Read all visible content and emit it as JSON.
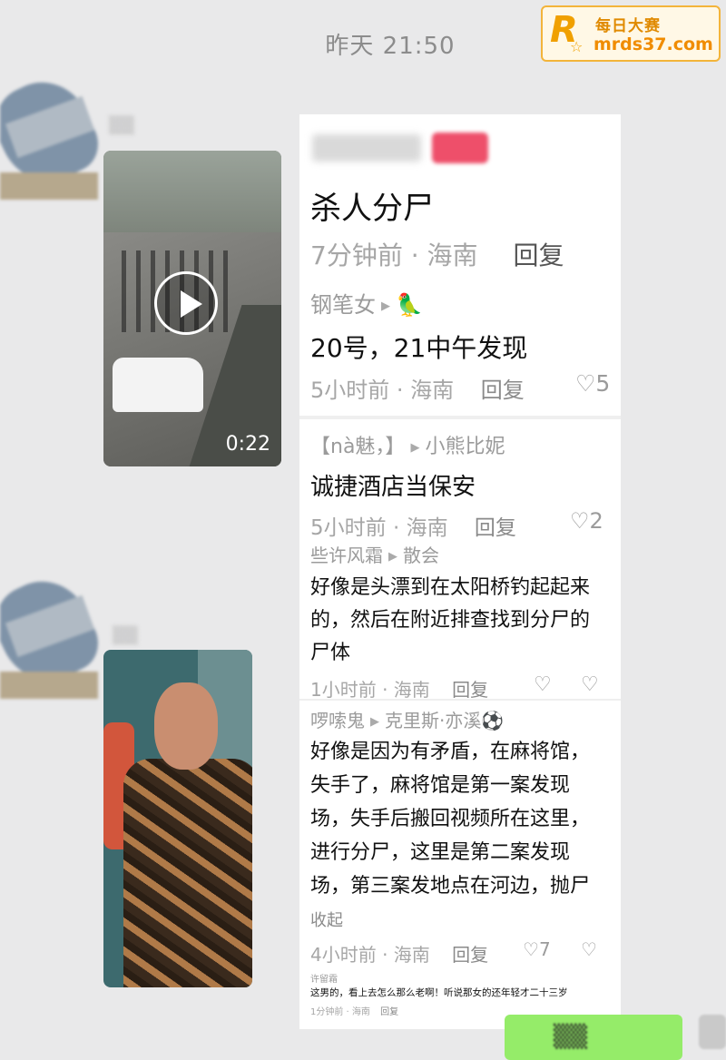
{
  "timestamp": "昨天 21:50",
  "watermark": {
    "letter": "R",
    "site_cn": "每日大赛",
    "site_url": "mrds37.com"
  },
  "video_message": {
    "duration": "0:22"
  },
  "comments": {
    "post": {
      "title": "杀人分尸",
      "meta": "7分钟前 · 海南",
      "reply": "回复"
    },
    "items": [
      {
        "user": "钢笔女",
        "badge": "🦜",
        "text": "20号，21中午发现",
        "meta": "5小时前 · 海南",
        "reply": "回复",
        "likes": "5"
      },
      {
        "user": "【nà魅，】",
        "reply_to": "小熊比妮",
        "text": "诚捷酒店当保安",
        "meta": "5小时前 · 海南",
        "reply": "回复",
        "likes": "2"
      },
      {
        "user": "些许风霜",
        "reply_to": "散会",
        "text": "好像是头漂到在太阳桥钓起起来的，然后在附近排查找到分尸的尸体",
        "meta": "1小时前 · 海南",
        "reply": "回复"
      },
      {
        "user": "啰嗦鬼",
        "reply_to": "克里斯·亦溪⚽",
        "text": "好像是因为有矛盾，在麻将馆，失手了，麻将馆是第一案发现场，失手后搬回视频所在这里，进行分尸，这里是第二案发现场，第三案发地点在河边，抛尸",
        "collapse": "收起",
        "meta": "4小时前 · 海南",
        "reply": "回复",
        "likes": "7"
      },
      {
        "user": "许留霜",
        "text": "这男的，看上去怎么那么老啊！听说那女的还年轻才二十三岁",
        "meta": "1分钟前 · 海南",
        "reply": "回复"
      }
    ]
  }
}
